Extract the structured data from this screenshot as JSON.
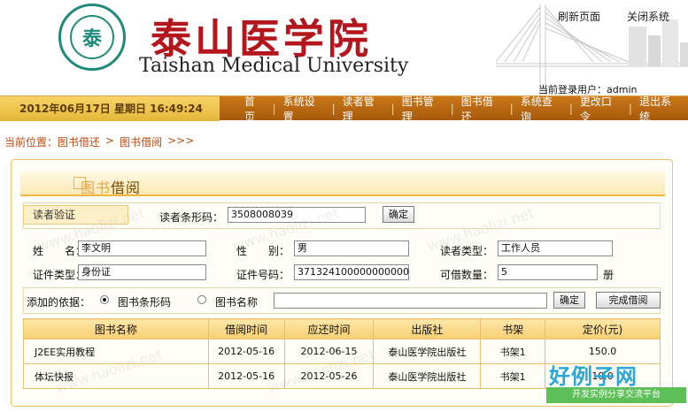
{
  "header": {
    "title_cn": "泰山医学院",
    "title_en": "Taishan Medical University",
    "logo_text": "泰",
    "top_links": [
      "刷新页面",
      "关闭系统"
    ],
    "login_label": "当前登录用户：admin"
  },
  "navbar": {
    "datetime": "2012年06月17日 星期日 16:49:24",
    "items": [
      "首页",
      "系统设置",
      "读者管理",
      "图书管理",
      "图书借还",
      "系统查询",
      "更改口令",
      "退出系统"
    ]
  },
  "breadcrumb": {
    "prefix": "当前位置：",
    "item1": "图书借还",
    "sep": ">",
    "item2": "图书借阅",
    "tail": ">>>"
  },
  "panel": {
    "title_part1": "图书",
    "title_part2": "借阅"
  },
  "reader_verify": {
    "section_label": "读者验证",
    "barcode_label": "读者条形码：",
    "barcode_value": "3508008039",
    "confirm_label": "确定"
  },
  "reader_info": {
    "name_label": "姓　　名：",
    "name_value": "李文明",
    "gender_label": "性　　别：",
    "gender_value": "男",
    "type_label": "读者类型：",
    "type_value": "工作人员",
    "id_type_label": "证件类型：",
    "id_type_value": "身份证",
    "id_no_label": "证件号码：",
    "id_no_value": "371324100000000000",
    "quota_label": "可借数量：",
    "quota_value": "5",
    "quota_unit": "册"
  },
  "add_book": {
    "basis_label": "添加的依据：",
    "option_barcode": "图书条形码",
    "option_name": "图书名称",
    "selected": "图书条形码",
    "input_value": "",
    "confirm_label": "确定",
    "finish_label": "完成借阅"
  },
  "table": {
    "headers": [
      "图书名称",
      "借阅时间",
      "应还时间",
      "出版社",
      "书架",
      "定价(元)"
    ],
    "rows": [
      [
        "J2EE实用教程",
        "2012-05-16",
        "2012-06-15",
        "泰山医学院出版社",
        "书架1",
        "150.0"
      ],
      [
        "体坛快报",
        "2012-05-16",
        "2012-05-26",
        "泰山医学院出版社",
        "书架1",
        "10.0"
      ]
    ]
  },
  "watermark": {
    "logo": "好例子网",
    "sub": "开发实例分享交流平台",
    "url": "www.haolizi.net"
  }
}
